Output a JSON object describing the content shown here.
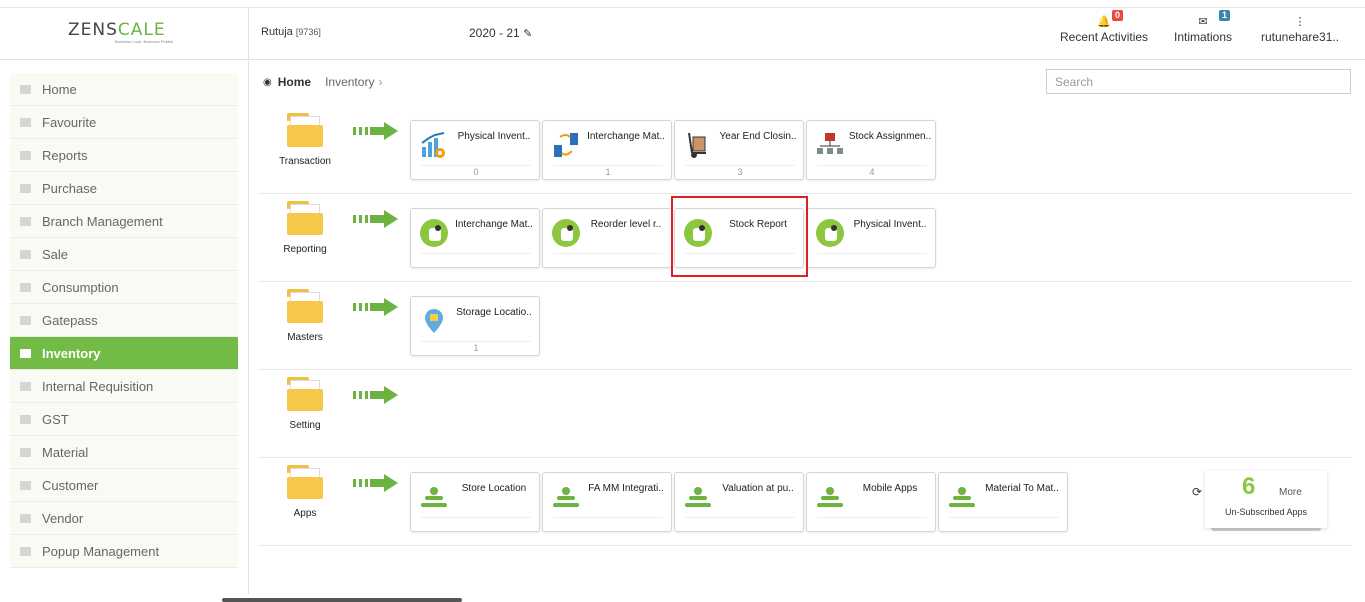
{
  "header": {
    "logo_text_a": "ZENS",
    "logo_text_b": "C",
    "logo_text_c": "A",
    "logo_text_d": "LE",
    "logo_tagline": "Business Loob. Business Pebble",
    "user_name": "Rutuja",
    "user_code": "[9736]",
    "year": "2020 - 21",
    "recent_activities": {
      "label": "Recent Activities",
      "count": "0"
    },
    "intimations": {
      "label": "Intimations",
      "count": "1"
    },
    "account": {
      "label": "rutunehare31.."
    }
  },
  "sidebar": {
    "items": [
      {
        "label": "Home"
      },
      {
        "label": "Favourite"
      },
      {
        "label": "Reports"
      },
      {
        "label": "Purchase"
      },
      {
        "label": "Branch Management"
      },
      {
        "label": "Sale"
      },
      {
        "label": "Consumption"
      },
      {
        "label": "Gatepass"
      },
      {
        "label": "Inventory"
      },
      {
        "label": "Internal Requisition"
      },
      {
        "label": "GST"
      },
      {
        "label": "Material"
      },
      {
        "label": "Customer"
      },
      {
        "label": "Vendor"
      },
      {
        "label": "Popup Management"
      }
    ],
    "active": "Inventory"
  },
  "breadcrumb": {
    "home": "Home",
    "current": "Inventory"
  },
  "search": {
    "placeholder": "Search"
  },
  "rows": {
    "transaction": {
      "label": "Transaction",
      "tiles": [
        {
          "name": "Physical Invent..",
          "count": "0"
        },
        {
          "name": "Interchange Mat..",
          "count": "1"
        },
        {
          "name": "Year End Closin..",
          "count": "3"
        },
        {
          "name": "Stock Assignmen..",
          "count": "4"
        }
      ]
    },
    "reporting": {
      "label": "Reporting",
      "tiles": [
        {
          "name": "Interchange Mat.."
        },
        {
          "name": "Reorder level r.."
        },
        {
          "name": "Stock Report"
        },
        {
          "name": "Physical Invent.."
        }
      ]
    },
    "masters": {
      "label": "Masters",
      "tiles": [
        {
          "name": "Storage Locatio..",
          "count": "1"
        }
      ]
    },
    "setting": {
      "label": "Setting"
    },
    "apps": {
      "label": "Apps",
      "tiles": [
        {
          "name": "Store Location"
        },
        {
          "name": "FA MM Integrati.."
        },
        {
          "name": "Valuation at pu.."
        },
        {
          "name": "Mobile Apps"
        },
        {
          "name": "Material To Mat.."
        }
      ]
    }
  },
  "more_apps": {
    "count": "6",
    "more_label": "More",
    "sub_label": "Un-Subscribed Apps"
  },
  "colors": {
    "accent": "#72bb46",
    "highlight": "#e02020"
  }
}
